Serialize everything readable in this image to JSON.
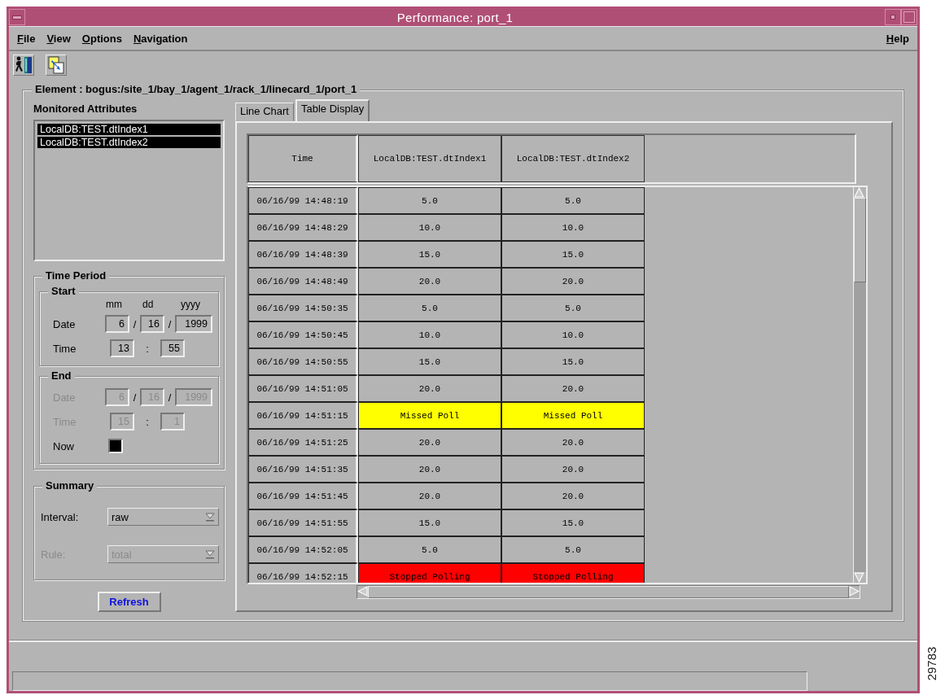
{
  "window": {
    "title": "Performance: port_1"
  },
  "menu": [
    {
      "label": "File"
    },
    {
      "label": "View"
    },
    {
      "label": "Options"
    },
    {
      "label": "Navigation"
    }
  ],
  "help_menu": {
    "label": "Help"
  },
  "element": {
    "label": "Element : bogus:/site_1/bay_1/agent_1/rack_1/linecard_1/port_1"
  },
  "monitored_attributes": {
    "title": "Monitored Attributes",
    "items": [
      {
        "label": "LocalDB:TEST.dtIndex1",
        "selected": true
      },
      {
        "label": "LocalDB:TEST.dtIndex2",
        "selected": true
      }
    ]
  },
  "time_period": {
    "title": "Time Period",
    "start": {
      "title": "Start",
      "disabled": false,
      "mm_label": "mm",
      "dd_label": "dd",
      "yyyy_label": "yyyy",
      "date_label": "Date",
      "month": "6",
      "date_separators": [
        "/",
        "/"
      ],
      "day": "16",
      "year": "1999",
      "time_label": "Time",
      "hour": "13",
      "time_separator": ":",
      "minute": "55"
    },
    "end": {
      "title": "End",
      "disabled": true,
      "date_label": "Date",
      "month": "6",
      "date_separators": [
        "/",
        "/"
      ],
      "day": "16",
      "year": "1999",
      "time_label": "Time",
      "hour": "15",
      "time_separator": ":",
      "minute": "1"
    },
    "now": {
      "label": "Now",
      "checked": true
    }
  },
  "summary": {
    "title": "Summary",
    "interval": {
      "label": "Interval:",
      "value": "raw",
      "disabled": false
    },
    "rule": {
      "label": "Rule:",
      "value": "total",
      "disabled": true
    }
  },
  "refresh_button": {
    "label": "Refresh"
  },
  "tabs": [
    {
      "label": "Line Chart",
      "selected": false
    },
    {
      "label": "Table Display",
      "selected": true
    }
  ],
  "table": {
    "columns": [
      "Time",
      "LocalDB:TEST.dtIndex1",
      "LocalDB:TEST.dtIndex2"
    ],
    "rows": [
      {
        "cells": [
          {
            "text": "06/16/99 14:48:19",
            "kind": "time"
          },
          {
            "text": "5.0",
            "kind": "value"
          },
          {
            "text": "5.0",
            "kind": "value"
          }
        ]
      },
      {
        "cells": [
          {
            "text": "06/16/99 14:48:29",
            "kind": "time"
          },
          {
            "text": "10.0",
            "kind": "value"
          },
          {
            "text": "10.0",
            "kind": "value"
          }
        ]
      },
      {
        "cells": [
          {
            "text": "06/16/99 14:48:39",
            "kind": "time"
          },
          {
            "text": "15.0",
            "kind": "value"
          },
          {
            "text": "15.0",
            "kind": "value"
          }
        ]
      },
      {
        "cells": [
          {
            "text": "06/16/99 14:48:49",
            "kind": "time"
          },
          {
            "text": "20.0",
            "kind": "value"
          },
          {
            "text": "20.0",
            "kind": "value"
          }
        ]
      },
      {
        "cells": [
          {
            "text": "06/16/99 14:50:35",
            "kind": "time"
          },
          {
            "text": "5.0",
            "kind": "value"
          },
          {
            "text": "5.0",
            "kind": "value"
          }
        ]
      },
      {
        "cells": [
          {
            "text": "06/16/99 14:50:45",
            "kind": "time"
          },
          {
            "text": "10.0",
            "kind": "value"
          },
          {
            "text": "10.0",
            "kind": "value"
          }
        ]
      },
      {
        "cells": [
          {
            "text": "06/16/99 14:50:55",
            "kind": "time"
          },
          {
            "text": "15.0",
            "kind": "value"
          },
          {
            "text": "15.0",
            "kind": "value"
          }
        ]
      },
      {
        "cells": [
          {
            "text": "06/16/99 14:51:05",
            "kind": "time"
          },
          {
            "text": "20.0",
            "kind": "value"
          },
          {
            "text": "20.0",
            "kind": "value"
          }
        ]
      },
      {
        "cells": [
          {
            "text": "06/16/99 14:51:15",
            "kind": "time"
          },
          {
            "text": "Missed Poll",
            "kind": "missed"
          },
          {
            "text": "Missed Poll",
            "kind": "missed"
          }
        ]
      },
      {
        "cells": [
          {
            "text": "06/16/99 14:51:25",
            "kind": "time"
          },
          {
            "text": "20.0",
            "kind": "value"
          },
          {
            "text": "20.0",
            "kind": "value"
          }
        ]
      },
      {
        "cells": [
          {
            "text": "06/16/99 14:51:35",
            "kind": "time"
          },
          {
            "text": "20.0",
            "kind": "value"
          },
          {
            "text": "20.0",
            "kind": "value"
          }
        ]
      },
      {
        "cells": [
          {
            "text": "06/16/99 14:51:45",
            "kind": "time"
          },
          {
            "text": "20.0",
            "kind": "value"
          },
          {
            "text": "20.0",
            "kind": "value"
          }
        ]
      },
      {
        "cells": [
          {
            "text": "06/16/99 14:51:55",
            "kind": "time"
          },
          {
            "text": "15.0",
            "kind": "value"
          },
          {
            "text": "15.0",
            "kind": "value"
          }
        ]
      },
      {
        "cells": [
          {
            "text": "06/16/99 14:52:05",
            "kind": "time"
          },
          {
            "text": "5.0",
            "kind": "value"
          },
          {
            "text": "5.0",
            "kind": "value"
          }
        ]
      },
      {
        "cells": [
          {
            "text": "06/16/99 14:52:15",
            "kind": "time"
          },
          {
            "text": "Stopped Polling",
            "kind": "stopped"
          },
          {
            "text": "Stopped Polling",
            "kind": "stopped"
          }
        ]
      }
    ]
  },
  "figure_number": "29783"
}
